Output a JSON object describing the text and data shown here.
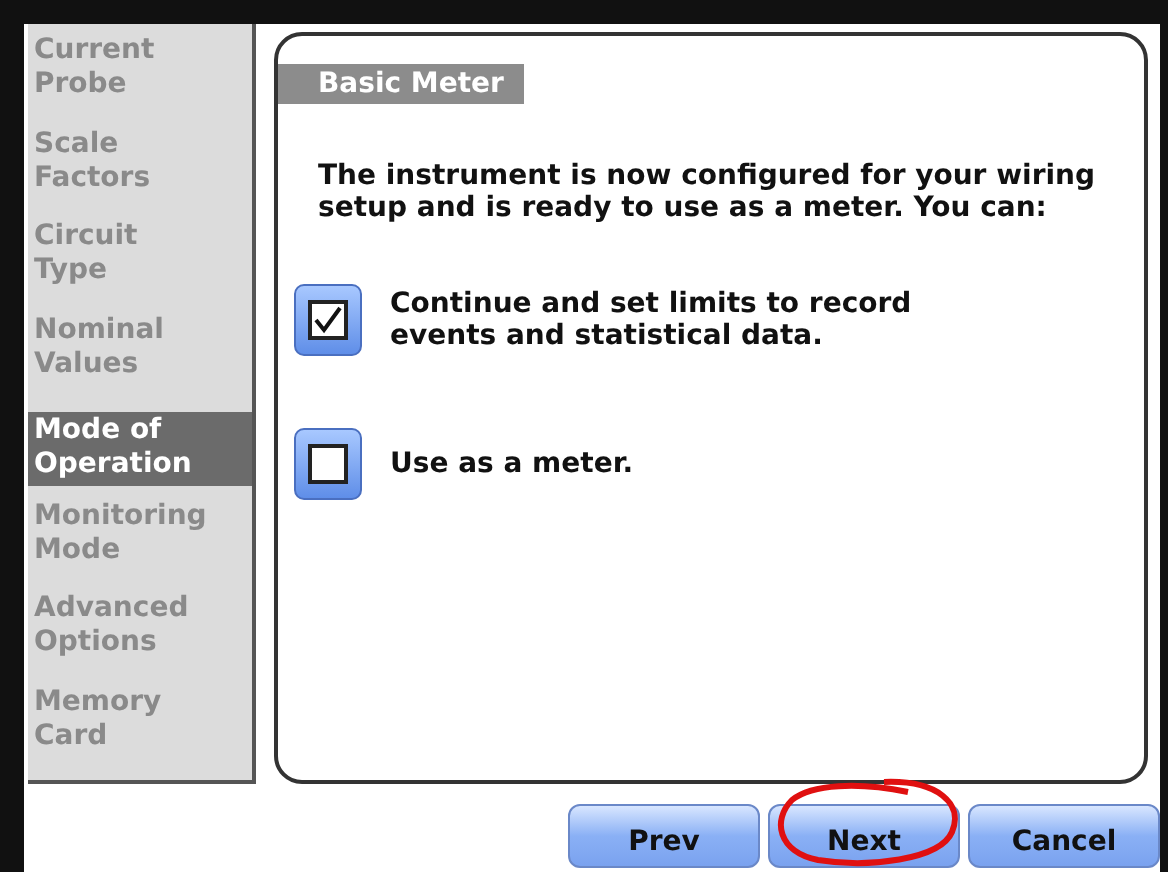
{
  "sidebar": {
    "items": [
      {
        "label": "Current Probe",
        "selected": false
      },
      {
        "label": "Scale Factors",
        "selected": false
      },
      {
        "label": "Circuit Type",
        "selected": false
      },
      {
        "label": "Nominal Values",
        "selected": false
      },
      {
        "label": "Mode of Operation",
        "selected": true
      },
      {
        "label": "Monitoring Mode",
        "selected": false
      },
      {
        "label": "Advanced Options",
        "selected": false
      },
      {
        "label": "Memory Card",
        "selected": false
      }
    ]
  },
  "panel": {
    "title": "Basic Meter",
    "intro": "The instrument is now configured for your wiring setup and is ready to use as a meter. You can:",
    "options": [
      {
        "label": "Continue and set limits to record events and statistical data.",
        "checked": true
      },
      {
        "label": "Use as a meter.",
        "checked": false
      }
    ]
  },
  "buttons": [
    {
      "label": "Prev",
      "highlighted": false
    },
    {
      "label": "Next",
      "highlighted": true
    },
    {
      "label": "Cancel",
      "highlighted": false
    }
  ]
}
